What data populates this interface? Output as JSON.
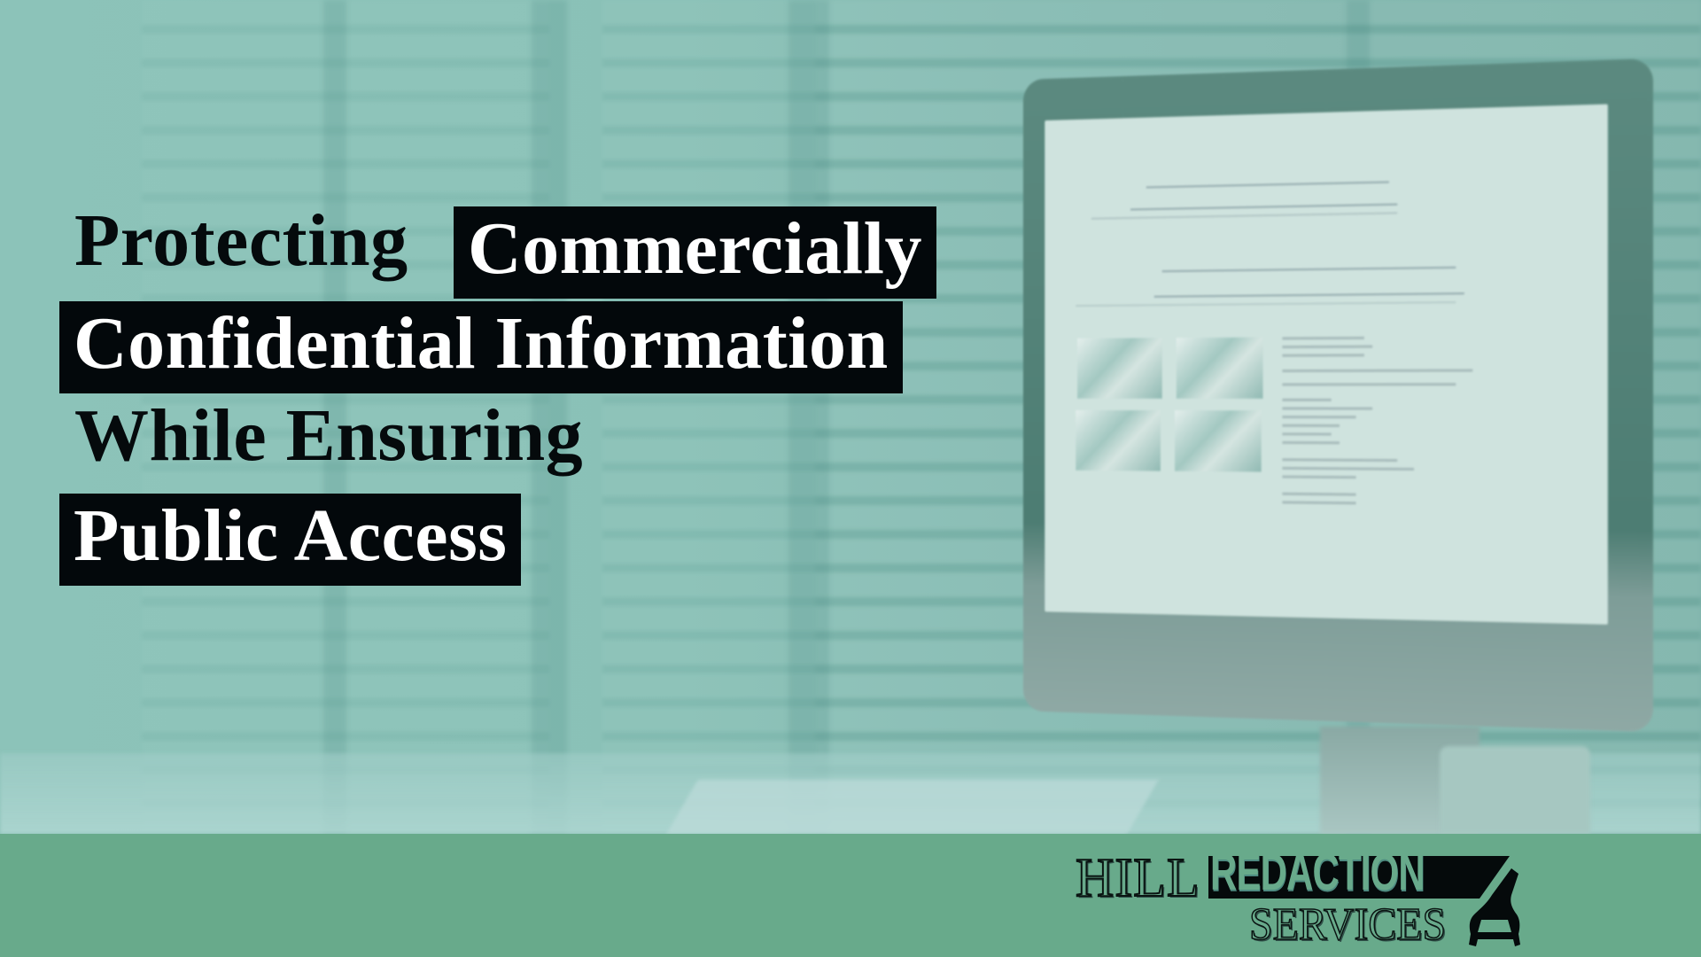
{
  "headline": {
    "line1_plain": "Protecting",
    "line1_boxed": "Commercially",
    "line2_boxed": "Confidential Information",
    "line3_plain": "While Ensuring",
    "line4_boxed": "Public Access"
  },
  "logo": {
    "word1": "HILL",
    "word2": "REDACTION",
    "word3": "SERVICES",
    "mark_icon": "redaction-bell-icon"
  },
  "colors": {
    "band": "#68aa8b",
    "overlay_teal": "#8cc2b8",
    "highlight_box": "#03080b",
    "text_dark": "#050a0c",
    "text_light": "#ffffff"
  }
}
